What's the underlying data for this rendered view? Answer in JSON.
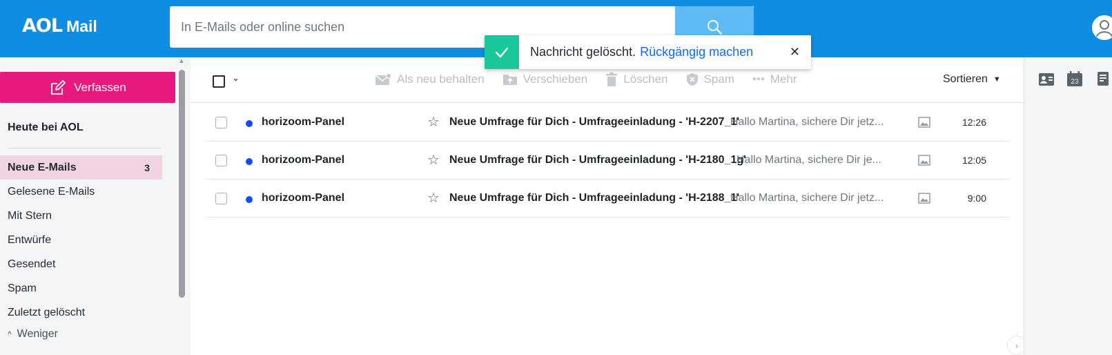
{
  "colors": {
    "brand": "#0f8de3",
    "compose": "#e8197c",
    "toast_ok": "#1ac79a",
    "unread_dot": "#0f4bff",
    "active_folder": "#f1d4e4"
  },
  "header": {
    "logo_aol": "AOL",
    "logo_mail": "Mail",
    "search_placeholder": "In E-Mails oder online suchen",
    "search_icon": "search-icon"
  },
  "toast": {
    "message": "Nachricht gelöscht.",
    "undo": "Rückgängig machen",
    "close": "✕"
  },
  "sidebar": {
    "compose": "Verfassen",
    "today": "Heute bei AOL",
    "folders": [
      {
        "label": "Neue E-Mails",
        "count": "3"
      },
      {
        "label": "Gelesene E-Mails",
        "count": ""
      },
      {
        "label": "Mit Stern",
        "count": ""
      },
      {
        "label": "Entwürfe",
        "count": ""
      },
      {
        "label": "Gesendet",
        "count": ""
      },
      {
        "label": "Spam",
        "count": ""
      },
      {
        "label": "Zuletzt gelöscht",
        "count": ""
      }
    ],
    "less": "Weniger"
  },
  "toolbar": {
    "keep_new": "Als neu behalten",
    "move": "Verschieben",
    "delete": "Löschen",
    "spam": "Spam",
    "more": "Mehr",
    "sort": "Sortieren"
  },
  "messages": [
    {
      "sender": "horizoom-Panel",
      "subject": "Neue Umfrage für Dich - Umfrageeinladung - 'H-2207_1'",
      "preview": "Hallo Martina, sichere Dir jetz...",
      "time": "12:26"
    },
    {
      "sender": "horizoom-Panel",
      "subject": "Neue Umfrage für Dich - Umfrageeinladung - 'H-2180_1g'",
      "preview": "Hallo Martina, sichere Dir je...",
      "time": "12:05"
    },
    {
      "sender": "horizoom-Panel",
      "subject": "Neue Umfrage für Dich - Umfrageeinladung - 'H-2188_1'",
      "preview": "Hallo Martina, sichere Dir jetz...",
      "time": "9:00"
    }
  ],
  "rail": {
    "calendar_day": "23"
  }
}
